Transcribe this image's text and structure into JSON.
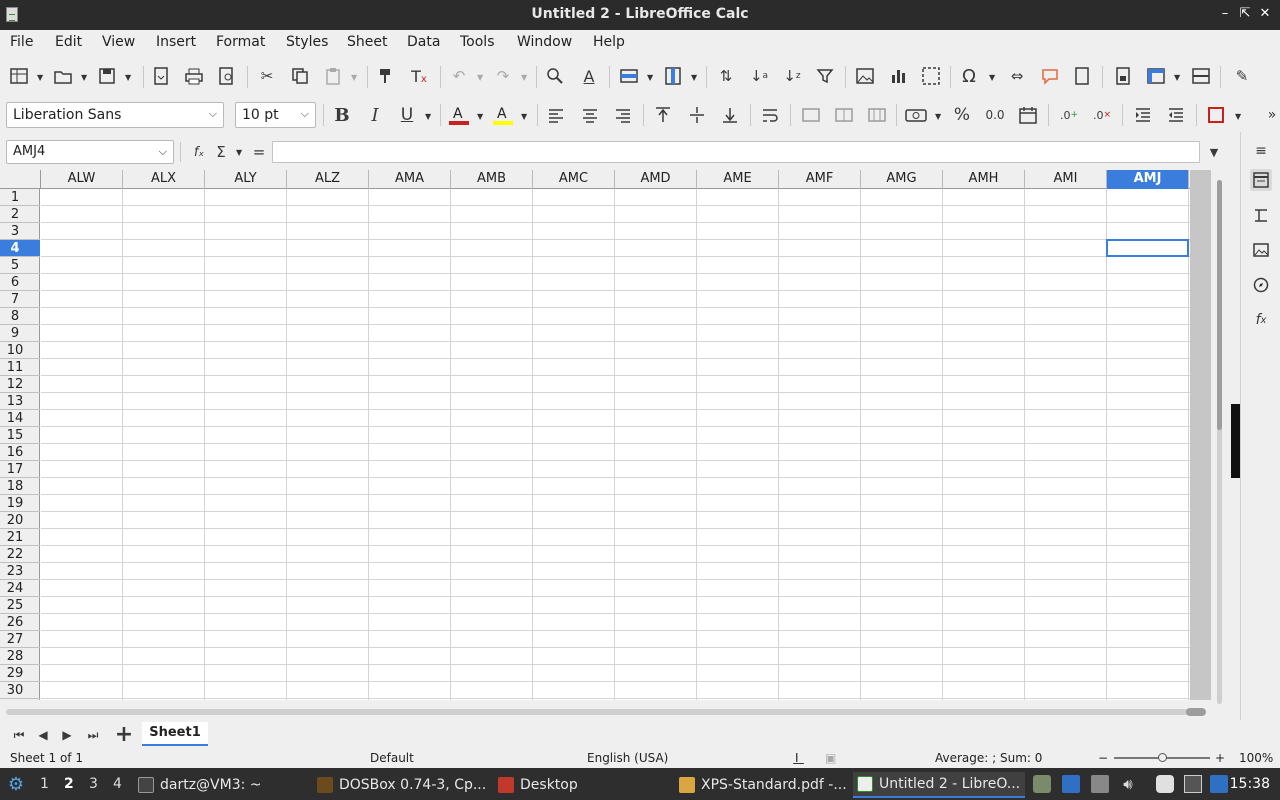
{
  "window": {
    "title": "Untitled 2 - LibreOffice Calc",
    "minimize": "–",
    "restore": "⇱",
    "close": "✕"
  },
  "menu": [
    "File",
    "Edit",
    "View",
    "Insert",
    "Format",
    "Styles",
    "Sheet",
    "Data",
    "Tools",
    "Window",
    "Help"
  ],
  "toolbar_formatting": {
    "font_name": "Liberation Sans",
    "font_size": "10 pt",
    "bold": "B",
    "italic": "I",
    "underline": "U",
    "percent": "%",
    "decimal": "0.0"
  },
  "colors": {
    "accent": "#3b7ddd",
    "font_color": "#c9211e",
    "highlight": "#ffff00"
  },
  "formula_bar": {
    "name_box": "AMJ4",
    "fx": "fₓ",
    "sum": "Σ",
    "equals": "=",
    "value": ""
  },
  "columns": [
    "ALW",
    "ALX",
    "ALY",
    "ALZ",
    "AMA",
    "AMB",
    "AMC",
    "AMD",
    "AME",
    "AMF",
    "AMG",
    "AMH",
    "AMI",
    "AMJ"
  ],
  "selected_column": "AMJ",
  "rows": [
    "1",
    "2",
    "3",
    "4",
    "5",
    "6",
    "7",
    "8",
    "9",
    "10",
    "11",
    "12",
    "13",
    "14",
    "15",
    "16",
    "17",
    "18",
    "19",
    "20",
    "21",
    "22",
    "23",
    "24",
    "25",
    "26",
    "27",
    "28",
    "29",
    "30"
  ],
  "selected_row": "4",
  "sheet_tabs": {
    "add": "+",
    "tabs": [
      "Sheet1"
    ]
  },
  "status": {
    "sheet": "Sheet 1 of 1",
    "page_style": "Default",
    "language": "English (USA)",
    "aggregate": "Average: ; Sum: 0",
    "zoom_minus": "−",
    "zoom_plus": "+",
    "zoom": "100%",
    "zoom_level": 1.0
  },
  "taskbar": {
    "workspaces": [
      "1",
      "2",
      "3",
      "4"
    ],
    "active_workspace": "2",
    "tasks": [
      {
        "label": "dartz@VM3: ~",
        "icon": "terminal-icon"
      },
      {
        "label": "DOSBox 0.74-3, Cp...",
        "icon": "dosbox-icon"
      },
      {
        "label": "Desktop",
        "icon": "desktop-icon"
      },
      {
        "label": "XPS-Standard.pdf -...",
        "icon": "pdf-icon"
      },
      {
        "label": "Untitled 2 - LibreO...",
        "icon": "calc-icon"
      }
    ],
    "clock": "15:38"
  }
}
